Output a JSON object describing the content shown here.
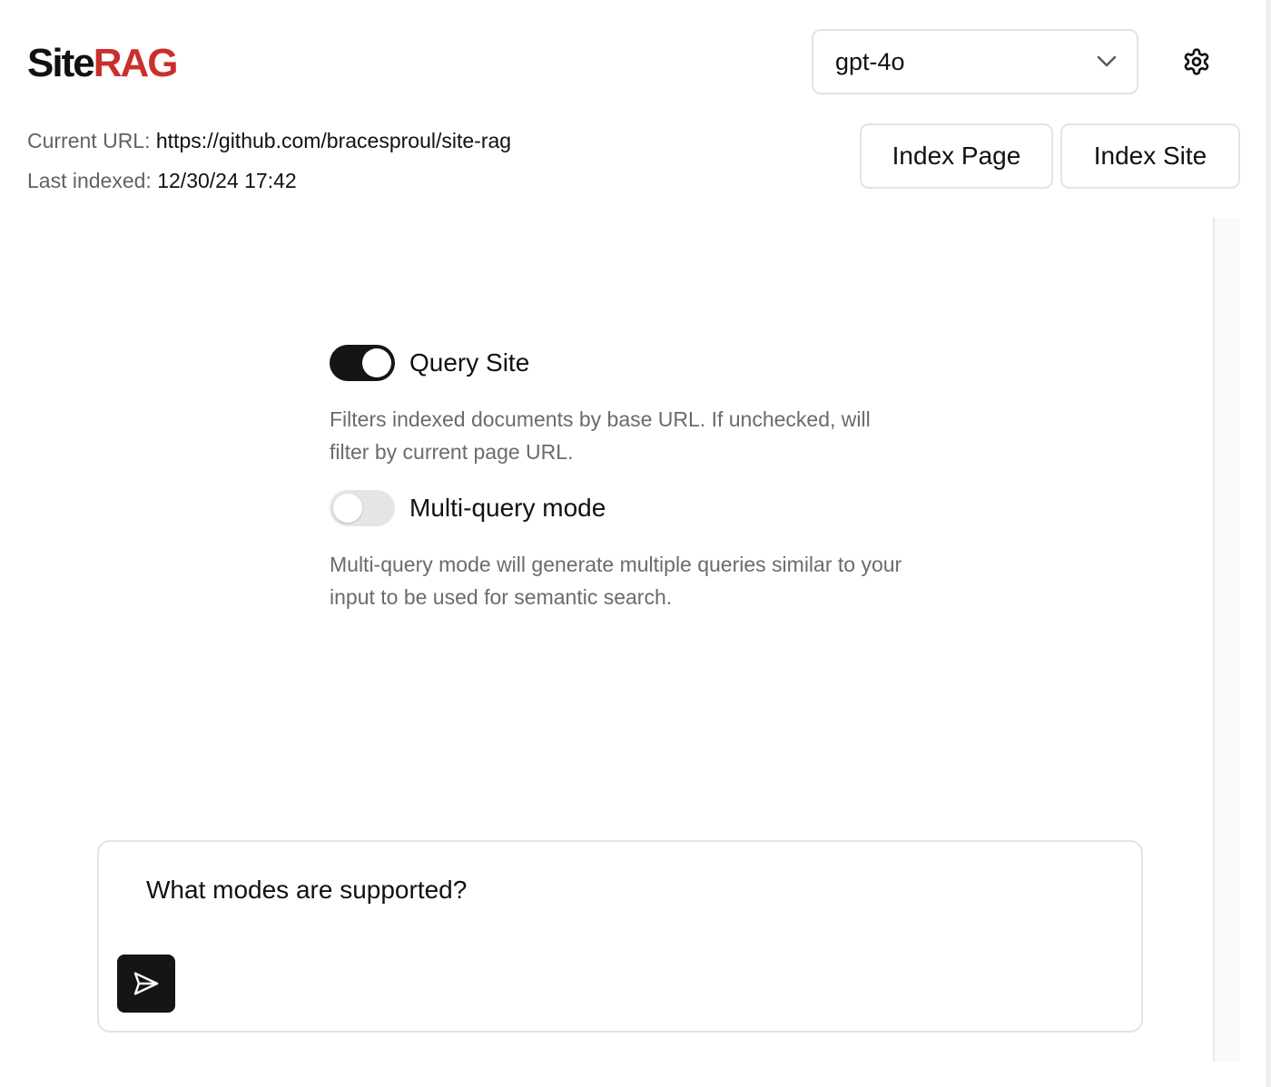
{
  "app": {
    "logo_primary": "Site",
    "logo_accent": "RAG",
    "accent_color": "#c9302c"
  },
  "header": {
    "model_select": {
      "value": "gpt-4o",
      "icon": "chevron-down-icon"
    },
    "settings_icon": "gear-icon"
  },
  "info": {
    "url_label": "Current URL:",
    "url_value": "https://github.com/bracesproul/site-rag",
    "indexed_label": "Last indexed:",
    "indexed_value": "12/30/24 17:42"
  },
  "actions": {
    "index_page": "Index Page",
    "index_site": "Index Site"
  },
  "options": {
    "query_site": {
      "label": "Query Site",
      "enabled": true,
      "description": "Filters indexed documents by base URL. If unchecked, will filter by current page URL."
    },
    "multi_query": {
      "label": "Multi-query mode",
      "enabled": false,
      "description": "Multi-query mode will generate multiple queries similar to your input to be used for semantic search."
    }
  },
  "chat": {
    "input_value": "What modes are supported?",
    "send_icon": "send-icon"
  }
}
